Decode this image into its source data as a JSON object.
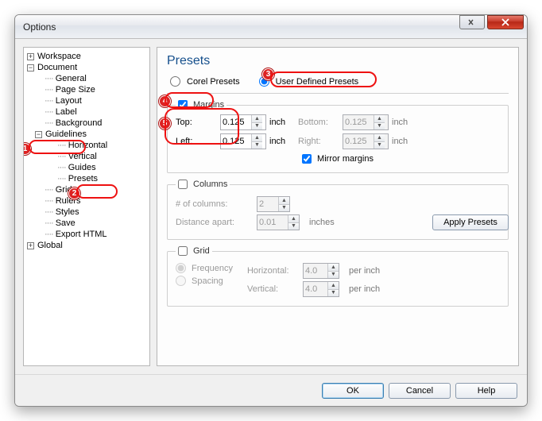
{
  "window": {
    "title": "Options"
  },
  "tree": {
    "workspace": "Workspace",
    "document": "Document",
    "general": "General",
    "page_size": "Page Size",
    "layout": "Layout",
    "label": "Label",
    "background": "Background",
    "guidelines": "Guidelines",
    "horizontal": "Horizontal",
    "vertical": "Vertical",
    "guides": "Guides",
    "presets": "Presets",
    "grid": "Grid",
    "rulers": "Rulers",
    "styles": "Styles",
    "save": "Save",
    "export_html": "Export HTML",
    "global": "Global"
  },
  "presets": {
    "title": "Presets",
    "radio_corel": "Corel Presets",
    "radio_user": "User Defined Presets",
    "margins": {
      "legend": "Margins",
      "checked": true,
      "top_label": "Top:",
      "top_value": "0.125",
      "left_label": "Left:",
      "left_value": "0.125",
      "bottom_label": "Bottom:",
      "bottom_value": "0.125",
      "right_label": "Right:",
      "right_value": "0.125",
      "unit": "inch",
      "mirror_label": "Mirror margins",
      "mirror_checked": true
    },
    "columns": {
      "legend": "Columns",
      "count_label": "# of columns:",
      "count_value": "2",
      "distance_label": "Distance apart:",
      "distance_value": "0.01",
      "unit": "inches"
    },
    "gridfs": {
      "legend": "Grid",
      "frequency": "Frequency",
      "spacing": "Spacing",
      "horizontal_label": "Horizontal:",
      "horizontal_value": "4.0",
      "vertical_label": "Vertical:",
      "vertical_value": "4.0",
      "unit": "per inch"
    },
    "apply": "Apply Presets"
  },
  "footer": {
    "ok": "OK",
    "cancel": "Cancel",
    "help": "Help"
  },
  "annotations": {
    "n1": "1",
    "n2": "2",
    "n3": "3",
    "n4": "4",
    "n5": "5"
  }
}
